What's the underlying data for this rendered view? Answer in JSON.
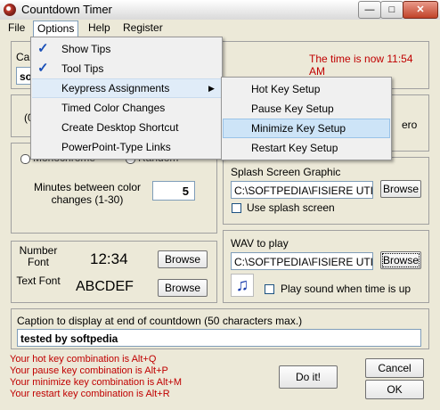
{
  "window": {
    "title": "Countdown Timer"
  },
  "menubar": {
    "file": "File",
    "options": "Options",
    "help": "Help",
    "register": "Register"
  },
  "options_menu": {
    "items": [
      {
        "label": "Show Tips",
        "checked": true
      },
      {
        "label": "Tool Tips",
        "checked": true
      },
      {
        "label": "Keypress Assignments",
        "submenu": true
      },
      {
        "label": "Timed Color Changes"
      },
      {
        "label": "Create Desktop Shortcut"
      },
      {
        "label": "PowerPoint-Type Links"
      }
    ]
  },
  "keypress_submenu": {
    "items": [
      "Hot Key Setup",
      "Pause Key Setup",
      "Minimize Key Setup",
      "Restart Key Setup"
    ],
    "highlighted": "Minimize Key Setup"
  },
  "caption": {
    "label_partial": "Cap",
    "value_partial": "so"
  },
  "clock": {
    "status": "The time is now 11:54 AM"
  },
  "partial_texts": {
    "left_paren": "(0",
    "right_zero": "ero"
  },
  "color": {
    "radio_left": "Monochrome",
    "radio_right": "Random",
    "minutes_label": "Minutes between color changes (1-30)",
    "minutes_value": "5"
  },
  "splash": {
    "label": "Splash Screen Graphic",
    "path": "C:\\SOFTPEDIA\\FISIERE UTILE",
    "browse": "Browse",
    "use_label": "Use splash screen"
  },
  "fonts": {
    "number_label": "Number Font",
    "number_sample": "12:34",
    "text_label": "Text Font",
    "text_sample": "ABCDEF",
    "browse": "Browse"
  },
  "wav": {
    "label": "WAV to play",
    "path": "C:\\SOFTPEDIA\\FISIERE UTILE",
    "browse": "Browse",
    "play_label": "Play sound when time is up"
  },
  "end_caption": {
    "label": "Caption to display at end of countdown (50 characters max.)",
    "value": "tested by softpedia"
  },
  "keys": {
    "hot": "Your hot key combination is Alt+Q",
    "pause": "Your pause key combination is Alt+P",
    "minimize": "Your minimize key combination is Alt+M",
    "restart": "Your restart key combination is Alt+R"
  },
  "buttons": {
    "doit": "Do it!",
    "cancel": "Cancel",
    "ok": "OK"
  },
  "colors": {
    "status_red": "#c00000",
    "highlight": "#cde4f7",
    "check_blue": "#1a50b8"
  }
}
